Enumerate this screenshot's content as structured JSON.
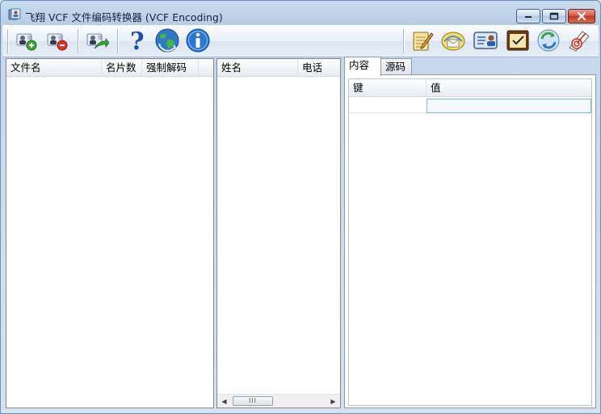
{
  "window": {
    "title": "飞翔 VCF 文件编码转换器 (VCF Encoding)",
    "accent_color": "#c9dcf0"
  },
  "caption_buttons": {
    "minimize": "minimize-icon",
    "maximize": "maximize-icon",
    "close": "close-icon"
  },
  "toolbar": {
    "left_icons": [
      "add-contact-icon",
      "remove-contact-icon",
      "export-contact-icon",
      "help-icon",
      "refresh-globe-icon",
      "info-icon"
    ],
    "right_icons": [
      "edit-notepad-icon",
      "mail-icon",
      "contact-card-icon",
      "checklist-icon",
      "sync-icon",
      "target-icon"
    ]
  },
  "file_list": {
    "columns": [
      "文件名",
      "名片数",
      "强制解码"
    ]
  },
  "contact_list": {
    "columns": [
      "姓名",
      "电话"
    ],
    "scroll_thumb": "III"
  },
  "detail": {
    "tabs": [
      "内容",
      "源码"
    ],
    "active_tab": 0,
    "columns": [
      "键",
      "值"
    ]
  }
}
